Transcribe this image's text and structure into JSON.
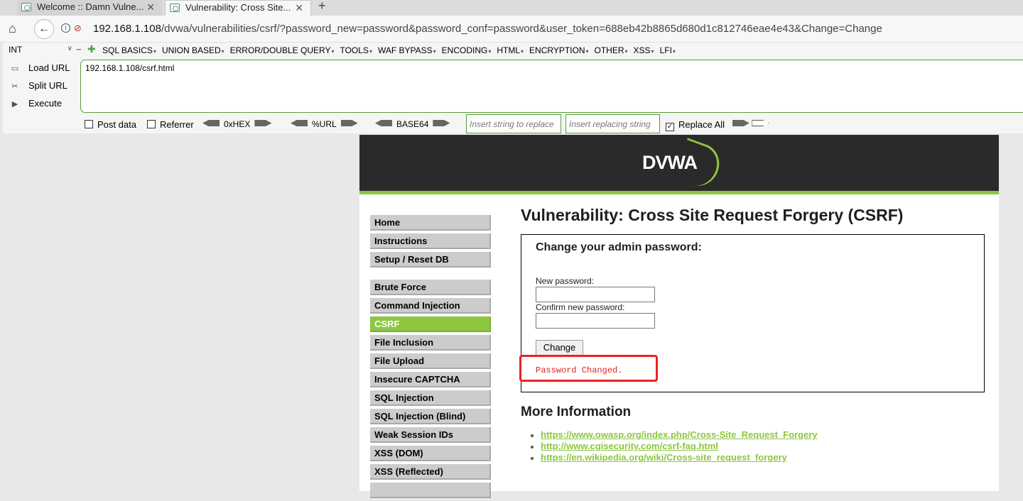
{
  "browser": {
    "tabs": [
      {
        "title": "Welcome :: Damn Vulne...",
        "active": false
      },
      {
        "title": "Vulnerability: Cross Site...",
        "active": true
      }
    ],
    "url_host": "192.168.1.108",
    "url_rest": "/dvwa/vulnerabilities/csrf/?password_new=password&password_conf=password&user_token=688eb42b8865d680d1c812746eae4e43&Change=Change"
  },
  "hackbar": {
    "select_value": "INT",
    "menu": [
      "SQL BASICS",
      "UNION BASED",
      "ERROR/DOUBLE QUERY",
      "TOOLS",
      "WAF BYPASS",
      "ENCODING",
      "HTML",
      "ENCRYPTION",
      "OTHER",
      "XSS",
      "LFI"
    ],
    "load_url": "Load URL",
    "split_url": "Split URL",
    "execute": "Execute",
    "url_value": "192.168.1.108/csrf.html",
    "post_data": "Post data",
    "referrer": "Referrer",
    "hex": "0xHEX",
    "urlenc": "%URL",
    "base64": "BASE64",
    "insert_placeholder": "Insert string to replace",
    "replace_placeholder": "Insert replacing string",
    "replace_all": "Replace All"
  },
  "dvwa": {
    "logo": "DVWA",
    "menu": {
      "home": "Home",
      "instructions": "Instructions",
      "setup": "Setup / Reset DB",
      "brute": "Brute Force",
      "cmd": "Command Injection",
      "csrf": "CSRF",
      "fi": "File Inclusion",
      "upload": "File Upload",
      "captcha": "Insecure CAPTCHA",
      "sqli": "SQL Injection",
      "sqli_blind": "SQL Injection (Blind)",
      "weak_session": "Weak Session IDs",
      "xss_dom": "XSS (DOM)",
      "xss_reflected": "XSS (Reflected)"
    },
    "title": "Vulnerability: Cross Site Request Forgery (CSRF)",
    "form_heading": "Change your admin password:",
    "new_password_label": "New password:",
    "confirm_label": "Confirm new password:",
    "change_button": "Change",
    "message": "Password Changed.",
    "more_info": "More Information",
    "links": [
      "https://www.owasp.org/index.php/Cross-Site_Request_Forgery",
      "http://www.cgisecurity.com/csrf-faq.html",
      "https://en.wikipedia.org/wiki/Cross-site_request_forgery"
    ],
    "accent_color": "#8dc63f"
  }
}
